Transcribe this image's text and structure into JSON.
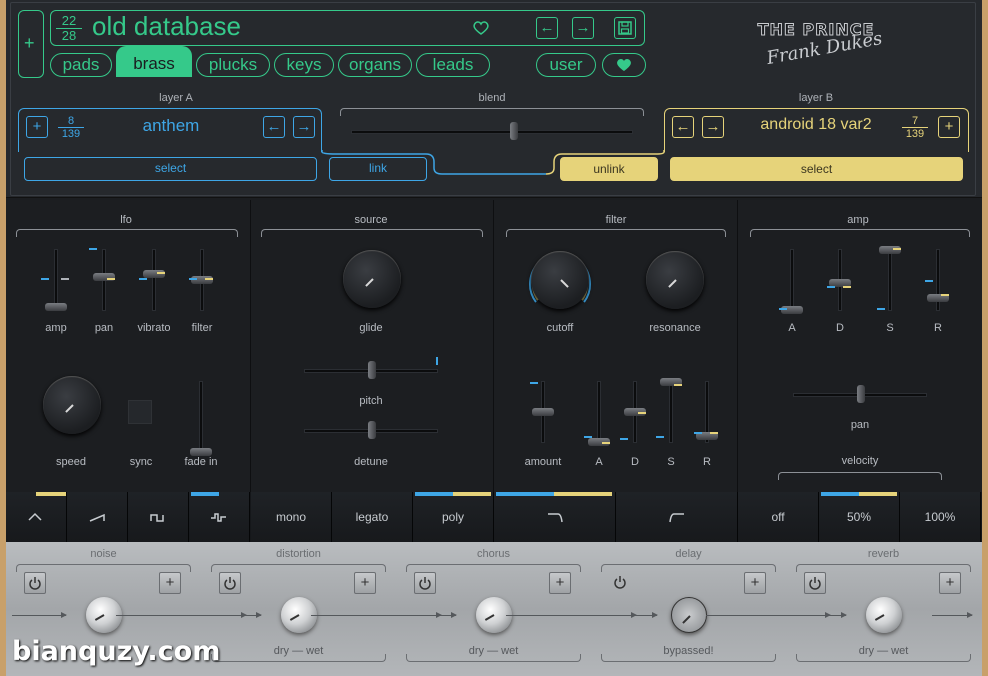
{
  "preset": {
    "index": "22",
    "total": "28",
    "name": "old database"
  },
  "categories": [
    {
      "label": "pads",
      "selected": false
    },
    {
      "label": "brass",
      "selected": true
    },
    {
      "label": "plucks",
      "selected": false
    },
    {
      "label": "keys",
      "selected": false
    },
    {
      "label": "organs",
      "selected": false
    },
    {
      "label": "leads",
      "selected": false
    }
  ],
  "user_label": "user",
  "brand": {
    "title": "THE PRINCE",
    "signature": "Frank Dukes"
  },
  "layer_a": {
    "title": "layer A",
    "index": "8",
    "total": "139",
    "name": "anthem",
    "select_label": "select",
    "link_label": "link"
  },
  "blend": {
    "title": "blend",
    "value": 0.58
  },
  "layer_b": {
    "title": "layer B",
    "index": "7",
    "total": "139",
    "name": "android 18 var2",
    "select_label": "select",
    "unlink_label": "unlink"
  },
  "lfo": {
    "title": "lfo",
    "sliders": [
      {
        "label": "amp",
        "value": 0.05
      },
      {
        "label": "pan",
        "value": 0.55
      },
      {
        "label": "vibrato",
        "value": 0.6
      },
      {
        "label": "filter",
        "value": 0.5
      }
    ],
    "speed_label": "speed",
    "sync_label": "sync",
    "fade_label": "fade in",
    "fade_value": 0.0
  },
  "source": {
    "title": "source",
    "glide_label": "glide",
    "pitch_label": "pitch",
    "detune_label": "detune"
  },
  "filter": {
    "title": "filter",
    "cutoff_label": "cutoff",
    "resonance_label": "resonance",
    "sliders": [
      {
        "label": "amount",
        "value": 0.5
      },
      {
        "label": "A",
        "value": 0.0
      },
      {
        "label": "D",
        "value": 0.5
      },
      {
        "label": "S",
        "value": 1.0
      },
      {
        "label": "R",
        "value": 0.1
      }
    ]
  },
  "amp": {
    "title": "amp",
    "sliders": [
      {
        "label": "A",
        "value": 0.0
      },
      {
        "label": "D",
        "value": 0.45
      },
      {
        "label": "S",
        "value": 1.0
      },
      {
        "label": "R",
        "value": 0.2
      }
    ],
    "pan_label": "pan",
    "velocity_label": "velocity"
  },
  "modes": {
    "lfo_shapes": [
      "sine-wave-icon",
      "saw-wave-icon",
      "square-wave-icon",
      "random-wave-icon"
    ],
    "voice": [
      "mono",
      "legato",
      "poly"
    ],
    "velocity": [
      "off",
      "50%",
      "100%"
    ]
  },
  "fx": [
    {
      "name": "noise",
      "footer": ""
    },
    {
      "name": "distortion",
      "footer": "dry — wet"
    },
    {
      "name": "chorus",
      "footer": "dry — wet"
    },
    {
      "name": "delay",
      "footer": "bypassed!"
    },
    {
      "name": "reverb",
      "footer": "dry — wet"
    }
  ],
  "watermark": "bianquzy.com",
  "colors": {
    "green": "#35c98a",
    "blue": "#3ea6e6",
    "yellow": "#e6d37a",
    "bg": "#1b1d20"
  }
}
